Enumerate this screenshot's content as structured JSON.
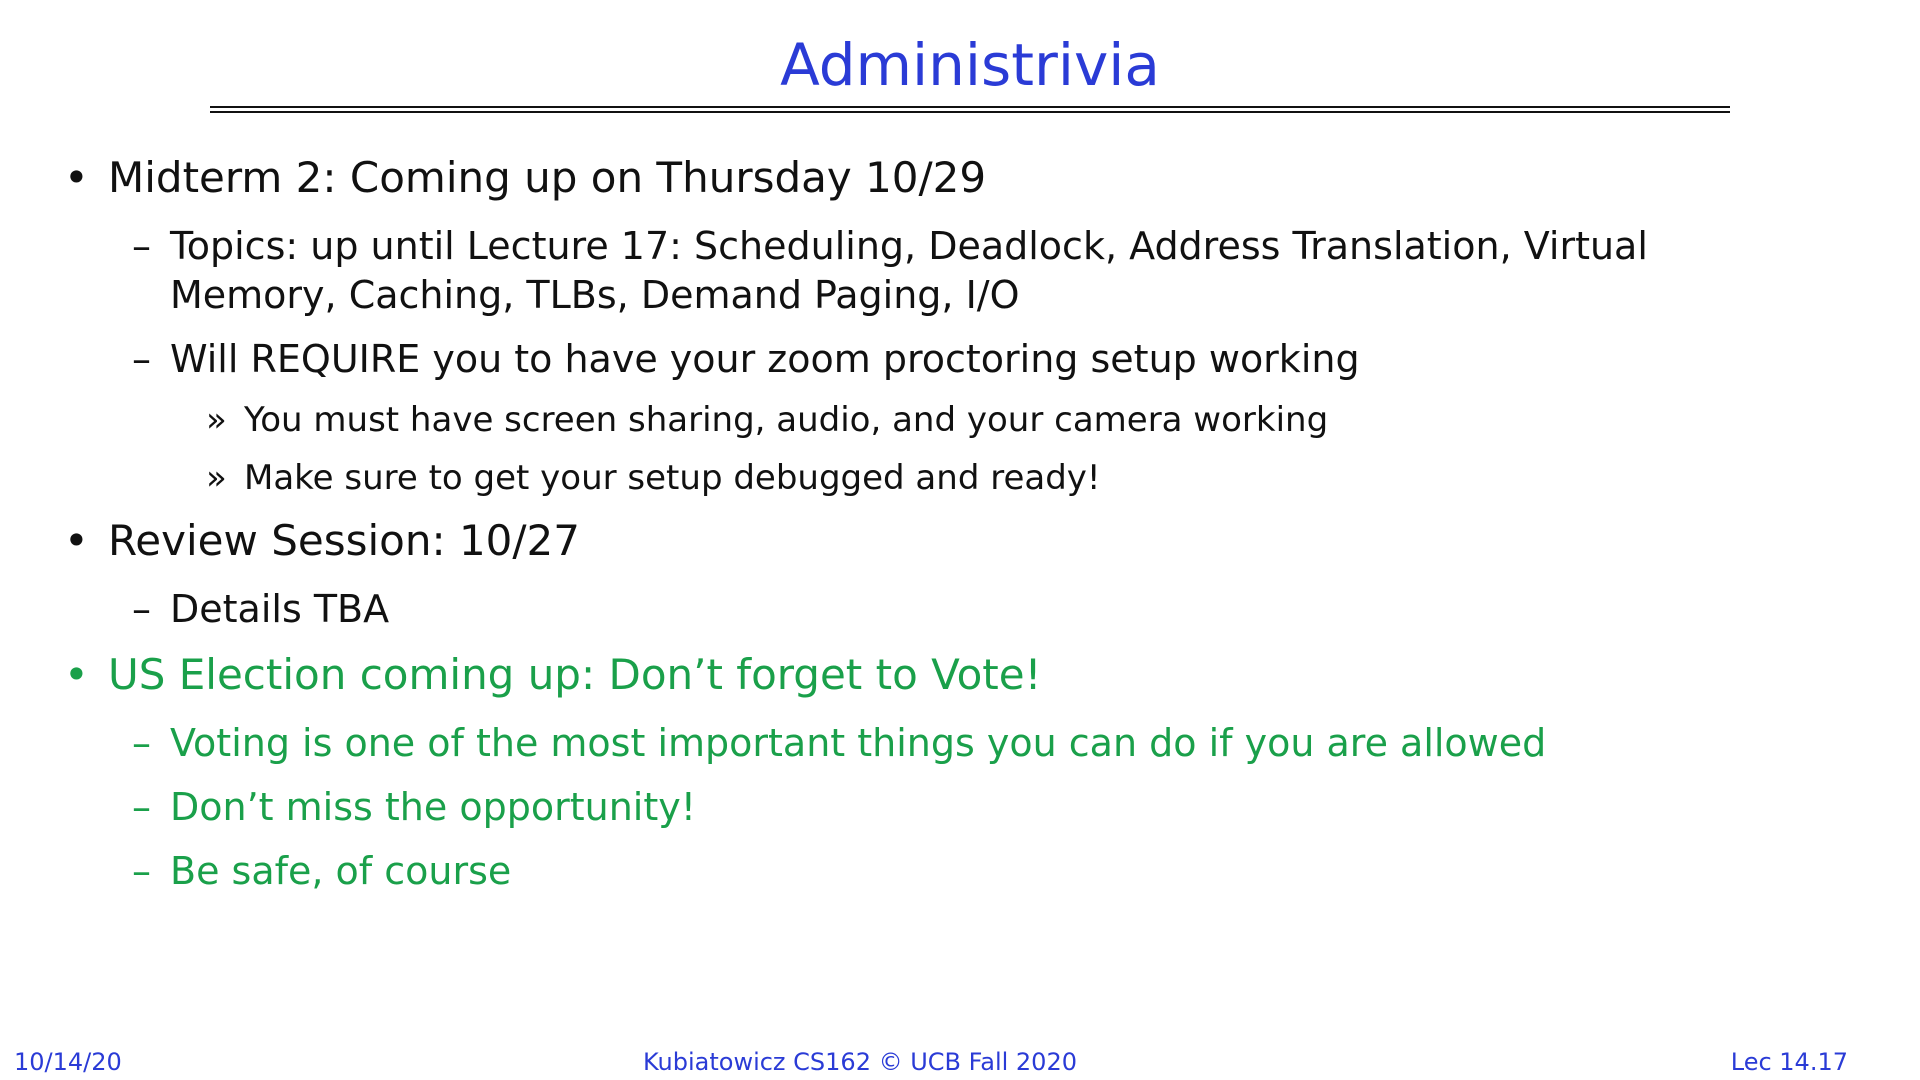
{
  "slide": {
    "title": "Administrivia",
    "bullets": [
      {
        "text": "Midterm 2: Coming up on Thursday 10/29",
        "subs": [
          {
            "text": "Topics: up until Lecture 17: Scheduling, Deadlock, Address Translation, Virtual Memory, Caching, TLBs, Demand Paging, I/O"
          },
          {
            "text": "Will REQUIRE you to have your zoom proctoring setup working",
            "subs": [
              "You must have screen sharing, audio, and your camera working",
              "Make sure to get your setup debugged and ready!"
            ]
          }
        ]
      },
      {
        "text": "Review Session: 10/27",
        "subs": [
          {
            "text": "Details TBA"
          }
        ]
      },
      {
        "text": "US Election coming up: Don’t forget to Vote!",
        "subs": [
          {
            "text": "Voting is one of the most important things you can do if you are allowed"
          },
          {
            "text": "Don’t miss the opportunity!"
          },
          {
            "text": "Be safe, of course"
          }
        ]
      }
    ],
    "markers": {
      "bullet": "•",
      "dash": "–",
      "chevron": "»"
    }
  },
  "footer": {
    "date": "10/14/20",
    "center": "Kubiatowicz CS162 © UCB Fall 2020",
    "page": "Lec 14.17"
  },
  "colors": {
    "title": "#2a3bd6",
    "highlight": "#1aa04a",
    "text": "#111111"
  }
}
